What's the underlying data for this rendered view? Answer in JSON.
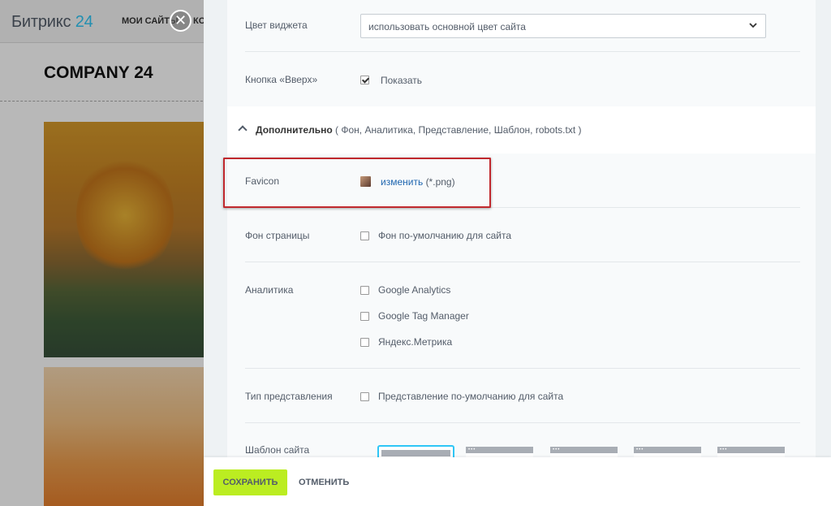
{
  "background": {
    "logo_text": "Битрикс",
    "logo_number": "24",
    "my_sites": "МОИ САЙТЫ",
    "truncated_menu": "КО",
    "company_name": "COMPANY 24"
  },
  "close_icon": "close-icon",
  "settings": {
    "widget_color": {
      "label": "Цвет виджета",
      "selected": "использовать основной цвет сайта"
    },
    "up_button": {
      "label": "Кнопка «Вверх»",
      "checkbox_label": "Показать",
      "checked": true
    },
    "additional": {
      "title": "Дополнительно",
      "details": "( Фон,  Аналитика,  Представление,  Шаблон,  robots.txt )"
    },
    "favicon": {
      "label": "Favicon",
      "link": "изменить",
      "hint": "(*.png)"
    },
    "page_bg": {
      "label": "Фон страницы",
      "checkbox_label": "Фон по-умолчанию для сайта"
    },
    "analytics": {
      "label": "Аналитика",
      "options": [
        "Google Analytics",
        "Google Tag Manager",
        "Яндекс.Метрика"
      ]
    },
    "view_type": {
      "label": "Тип представления",
      "checkbox_label": "Представление по-умолчанию для сайта"
    },
    "site_template": {
      "label": "Шаблон сайта"
    }
  },
  "footer": {
    "save": "СОХРАНИТЬ",
    "cancel": "ОТМЕНИТЬ"
  },
  "colors": {
    "accent_green": "#bbed21",
    "link_blue": "#2067b0",
    "highlight_red": "#c0282d",
    "selected_template": "#2fc6f6"
  }
}
